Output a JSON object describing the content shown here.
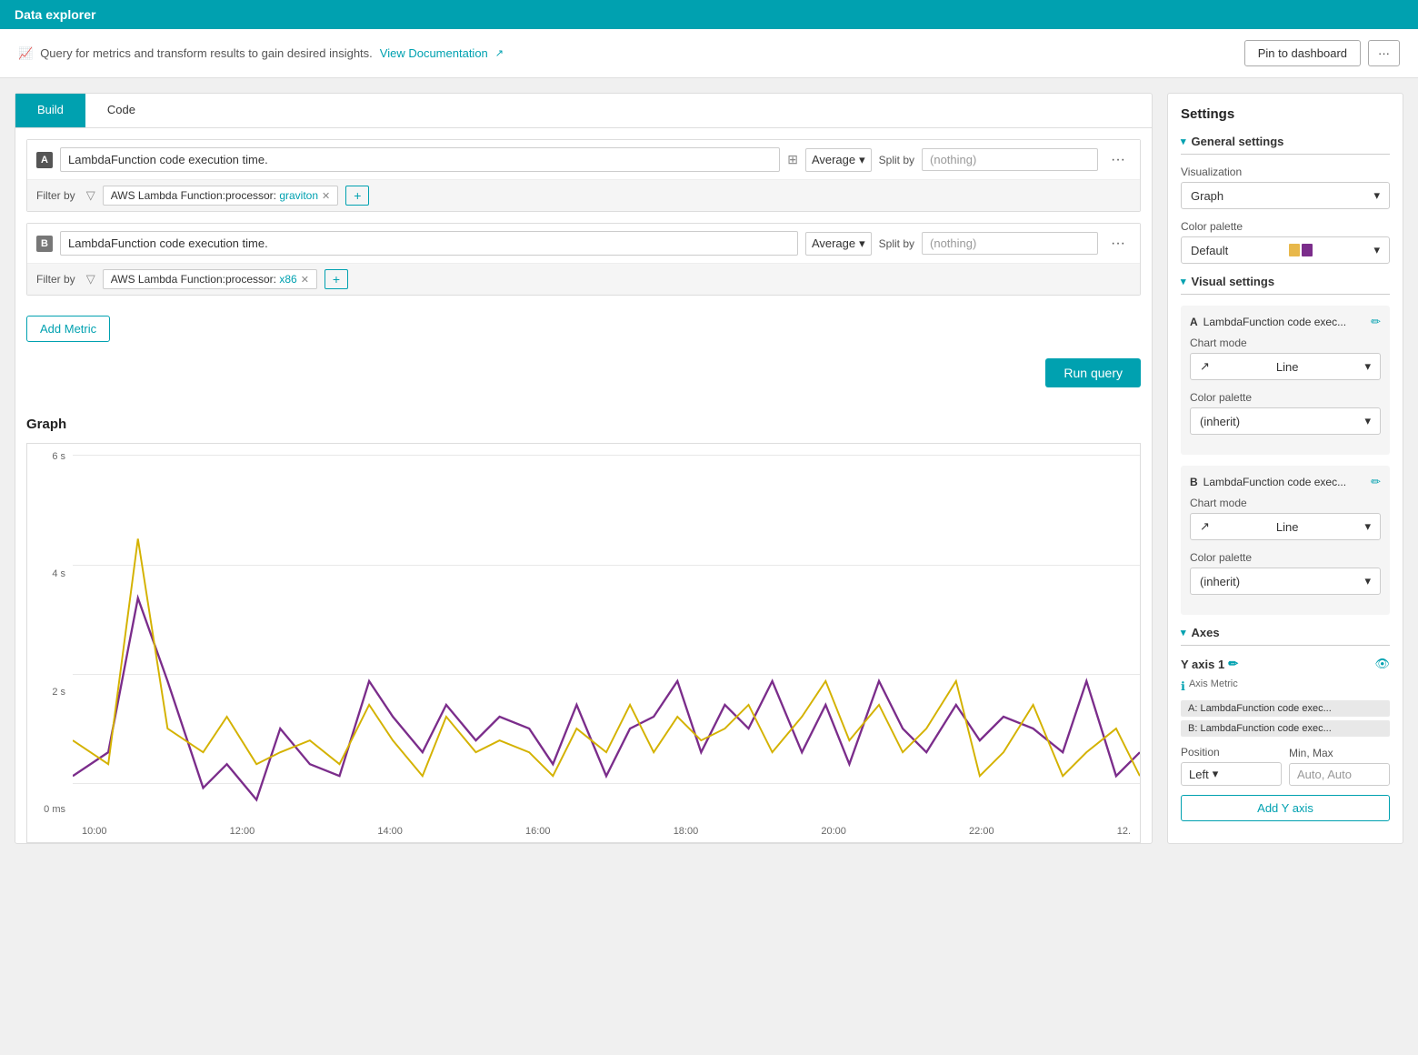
{
  "topbar": {
    "title": "Data explorer"
  },
  "header": {
    "description": "Query for metrics and transform results to gain desired insights.",
    "doc_link": "View Documentation",
    "pin_btn": "Pin to dashboard",
    "more_btn": "···"
  },
  "tabs": {
    "build": "Build",
    "code": "Code"
  },
  "metrics": [
    {
      "id": "A",
      "name": "LambdaFunction code execution time.",
      "aggregation": "Average",
      "split_by": "(nothing)",
      "filter_label": "Filter by",
      "filter_value": "AWS Lambda Function:processor: graviton",
      "filter_teal": "graviton"
    },
    {
      "id": "B",
      "name": "LambdaFunction code execution time.",
      "aggregation": "Average",
      "split_by": "(nothing)",
      "filter_label": "Filter by",
      "filter_value": "AWS Lambda Function:processor: x86",
      "filter_teal": "x86"
    }
  ],
  "add_metric_btn": "Add Metric",
  "run_query_btn": "Run query",
  "graph": {
    "title": "Graph",
    "y_axis": [
      "6 s",
      "4 s",
      "2 s",
      "0 ms"
    ],
    "x_axis": [
      "10:00",
      "12:00",
      "14:00",
      "16:00",
      "18:00",
      "20:00",
      "22:00",
      "12."
    ]
  },
  "settings": {
    "title": "Settings",
    "general_label": "General settings",
    "visualization_label": "Visualization",
    "visualization_value": "Graph",
    "color_palette_label": "Color palette",
    "color_palette_value": "Default",
    "visual_settings_label": "Visual settings",
    "metric_a": {
      "badge": "A",
      "name": "LambdaFunction code exec...",
      "chart_mode_label": "Chart mode",
      "chart_mode_value": "Line",
      "color_palette_label": "Color palette",
      "color_palette_value": "(inherit)"
    },
    "metric_b": {
      "badge": "B",
      "name": "LambdaFunction code exec...",
      "chart_mode_label": "Chart mode",
      "chart_mode_value": "Line",
      "color_palette_label": "Color palette",
      "color_palette_value": "(inherit)"
    },
    "axes_label": "Axes",
    "y_axis_1": "Y axis 1",
    "axis_metric_label": "Axis Metric",
    "axis_metric_a": "A: LambdaFunction code exec...",
    "axis_metric_b": "B: LambdaFunction code exec...",
    "position_label": "Position",
    "min_max_label": "Min, Max",
    "position_value": "Left",
    "min_max_value": "Auto, Auto",
    "add_y_axis_btn": "Add Y axis"
  }
}
